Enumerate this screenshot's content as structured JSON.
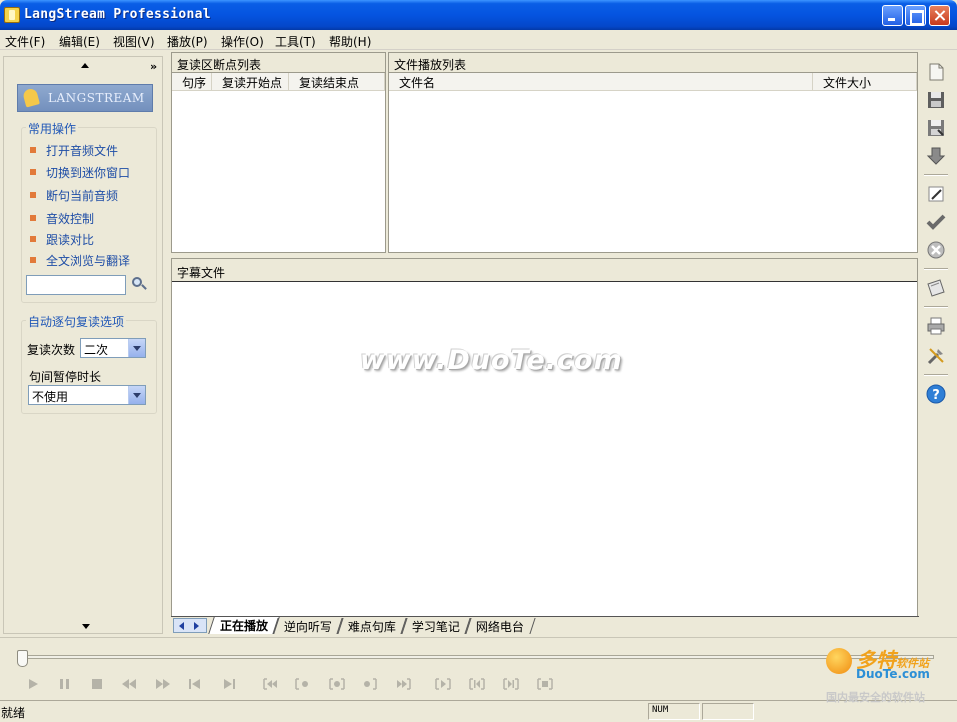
{
  "window": {
    "title": "LangStream Professional"
  },
  "menu": [
    "文件(F)",
    "编辑(E)",
    "视图(V)",
    "播放(P)",
    "操作(O)",
    "工具(T)",
    "帮助(H)"
  ],
  "sidebar": {
    "logo": "LANGSTREAM",
    "collapse_glyph": "»",
    "common_ops_title": "常用操作",
    "tasks": [
      "打开音频文件",
      "切换到迷你窗口",
      "断句当前音频",
      "音效控制",
      "跟读对比",
      "全文浏览与翻译"
    ],
    "search_value": "",
    "auto_repeat_title": "自动逐句复读选项",
    "repeat_count_label": "复读次数",
    "repeat_count_value": "二次",
    "pause_label": "句间暂停时长",
    "pause_value": "不使用"
  },
  "breakpoints": {
    "title": "复读区断点列表",
    "columns": [
      "句序",
      "复读开始点",
      "复读结束点"
    ]
  },
  "playlist": {
    "title": "文件播放列表",
    "columns": [
      "文件名",
      "文件大小"
    ]
  },
  "subtitle": {
    "title": "字幕文件"
  },
  "tabs": [
    "正在播放",
    "逆向听写",
    "难点句库",
    "学习笔记",
    "网络电台"
  ],
  "status": {
    "text": "就绪",
    "num": "NUM"
  },
  "watermark": "www.DuoTe.com",
  "corner_logo": {
    "main": "多特",
    "sub": "软件站",
    "site": "DuoTe.com",
    "tagline": "国内最安全的软件站"
  },
  "colors": {
    "titlebar": "#0554e0",
    "task_link": "#1e4da6",
    "bullet": "#e27a3a"
  }
}
